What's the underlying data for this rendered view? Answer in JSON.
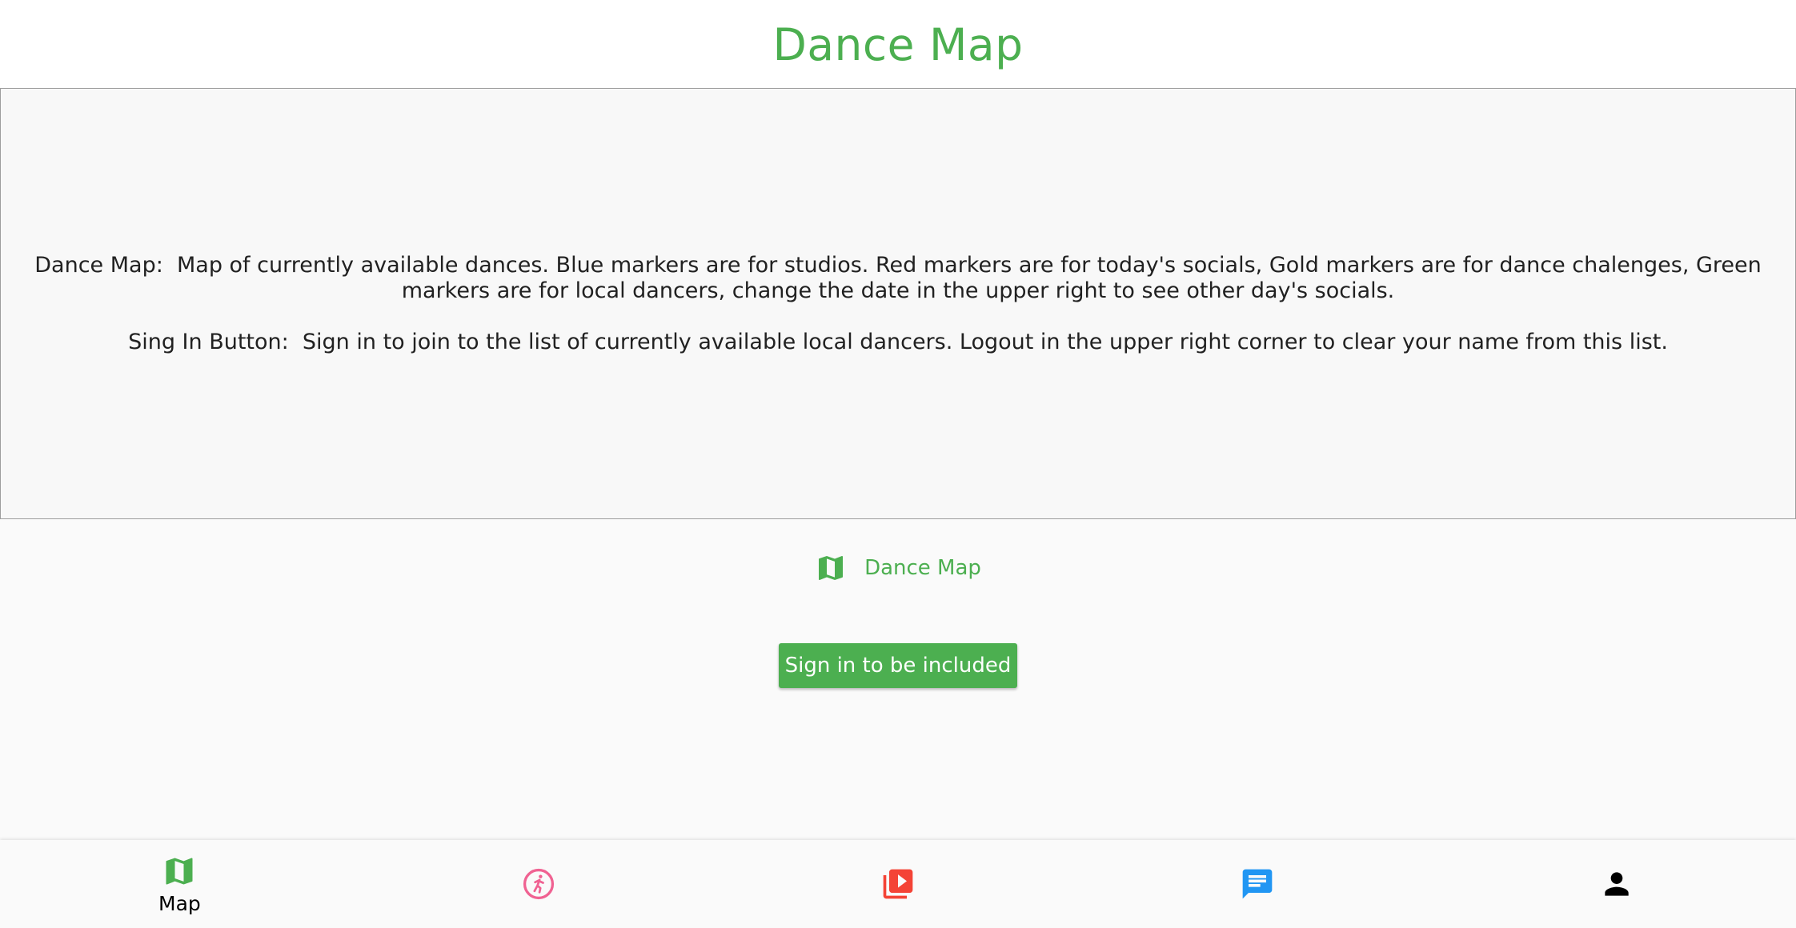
{
  "app_bar": {
    "title": "Dance Map",
    "title_color": "#4caf50"
  },
  "info_panel": {
    "dance_map_text": "Dance Map:  Map of currently available dances. Blue markers are for studios. Red markers are for today's socials, Gold markers are for dance chalenges, Green markers are for local dancers, change the date in the upper right to see other day's socials.",
    "sign_in_text": "Sing In Button:  Sign in to join to the list of currently available local dancers. Logout in the upper right corner to clear your name from this list."
  },
  "feature": {
    "icon": "map-icon",
    "label": "Dance Map"
  },
  "sign_in_button": {
    "label": "Sign in to be included",
    "color": "#4caf50"
  },
  "bottom_nav": {
    "items": [
      {
        "icon": "map-icon",
        "label": "Map",
        "color": "#4caf50",
        "selected": true
      },
      {
        "icon": "dancer-icon",
        "label": "",
        "color": "#f06292"
      },
      {
        "icon": "video-library-icon",
        "label": "",
        "color": "#f44336"
      },
      {
        "icon": "chat-icon",
        "label": "",
        "color": "#2196f3"
      },
      {
        "icon": "person-icon",
        "label": "",
        "color": "#000000"
      }
    ]
  }
}
